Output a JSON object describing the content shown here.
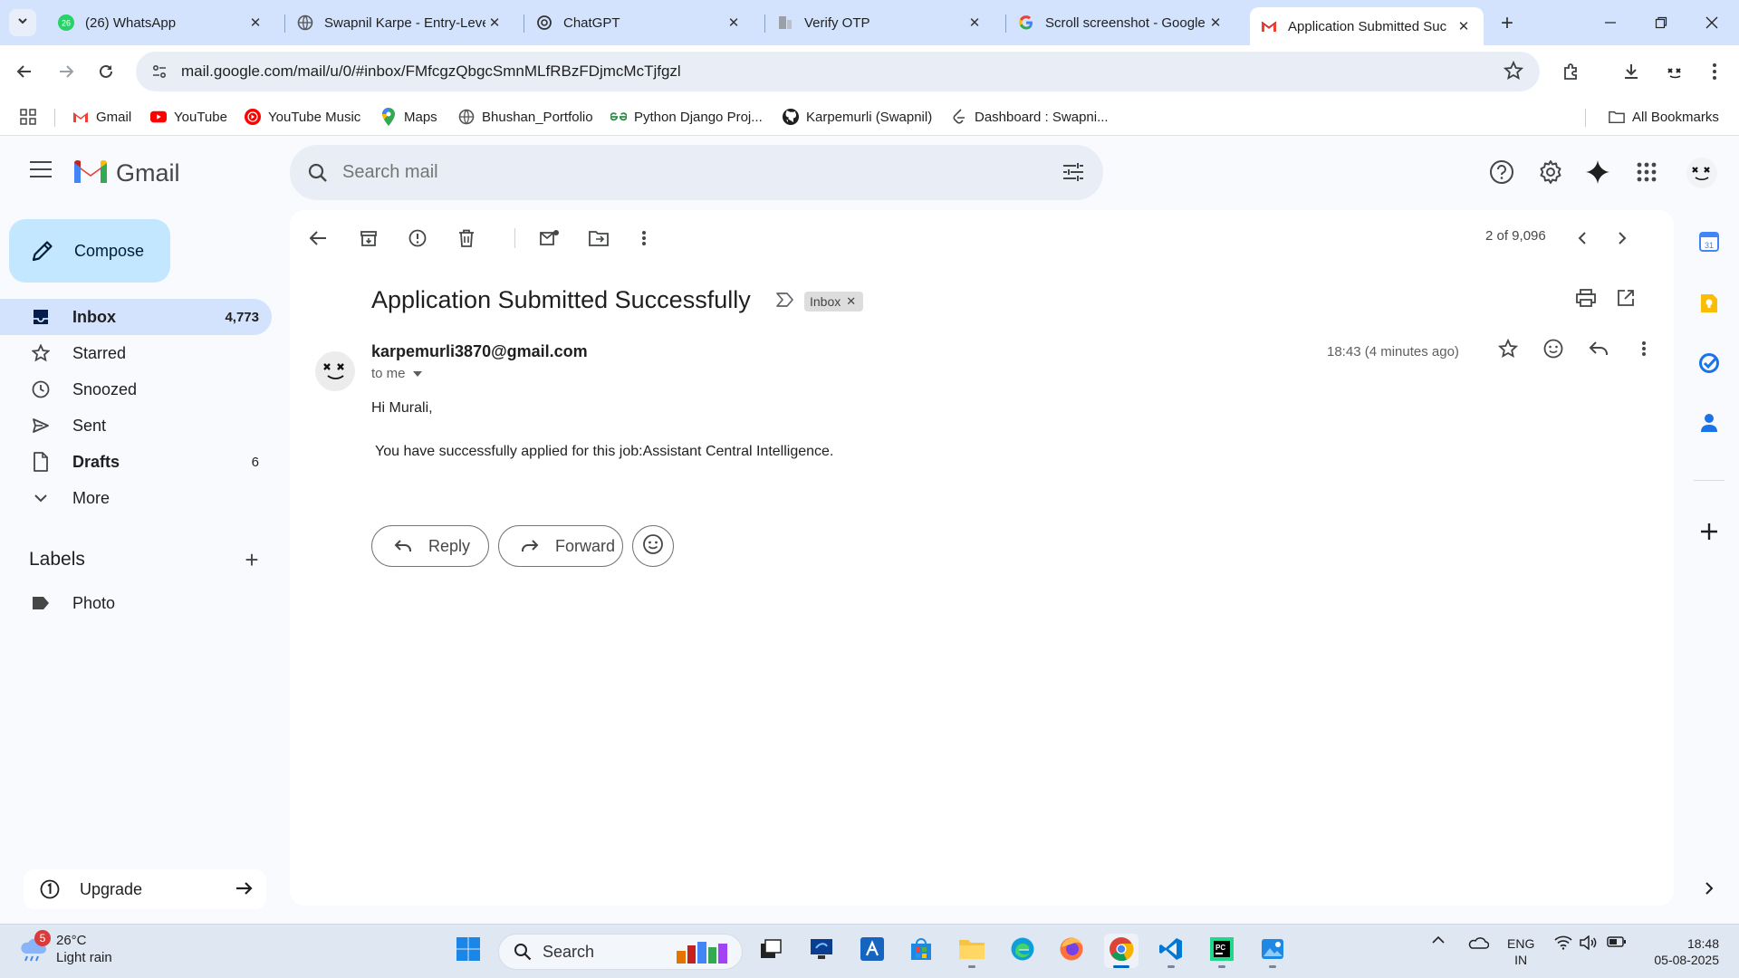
{
  "browser": {
    "tabs": [
      {
        "title": "(26) WhatsApp",
        "badge": "26",
        "icon": "whatsapp-icon"
      },
      {
        "title": "Swapnil Karpe - Entry-Leve",
        "icon": "globe-icon"
      },
      {
        "title": "ChatGPT",
        "icon": "chatgpt-icon"
      },
      {
        "title": "Verify OTP",
        "icon": "document-icon"
      },
      {
        "title": "Scroll screenshot - Google",
        "icon": "google-icon"
      },
      {
        "title": "Application Submitted Suc",
        "icon": "gmail-icon",
        "active": true
      }
    ],
    "url": "mail.google.com/mail/u/0/#inbox/FMfcgzQbgcSmnMLfRBzFDjmcMcTjfgzl",
    "bookmarks": [
      {
        "label": "Gmail",
        "icon": "gmail-icon"
      },
      {
        "label": "YouTube",
        "icon": "youtube-icon"
      },
      {
        "label": "YouTube Music",
        "icon": "youtube-music-icon"
      },
      {
        "label": "Maps",
        "icon": "maps-pin-icon"
      },
      {
        "label": "Bhushan_Portfolio",
        "icon": "globe-icon"
      },
      {
        "label": "Python Django Proj...",
        "icon": "geeks-icon"
      },
      {
        "label": "Karpemurli (Swapnil)",
        "icon": "github-icon"
      },
      {
        "label": "Dashboard : Swapni...",
        "icon": "leetcode-icon"
      }
    ],
    "all_bookmarks": "All Bookmarks"
  },
  "gmail": {
    "brand": "Gmail",
    "search_placeholder": "Search mail",
    "compose": "Compose",
    "nav": [
      {
        "label": "Inbox",
        "count": "4,773",
        "icon": "inbox-icon",
        "active": true,
        "bold": true
      },
      {
        "label": "Starred",
        "count": "",
        "icon": "star-icon"
      },
      {
        "label": "Snoozed",
        "count": "",
        "icon": "clock-icon"
      },
      {
        "label": "Sent",
        "count": "",
        "icon": "send-icon"
      },
      {
        "label": "Drafts",
        "count": "6",
        "icon": "draft-icon",
        "bold": true
      },
      {
        "label": "More",
        "count": "",
        "icon": "chevron-down-icon"
      }
    ],
    "labels_heading": "Labels",
    "labels": [
      {
        "label": "Photo",
        "icon": "label-icon"
      }
    ],
    "upgrade": "Upgrade",
    "pager": "2 of 9,096",
    "message": {
      "subject": "Application Submitted Successfully",
      "chip": "Inbox",
      "sender": "karpemurli3870@gmail.com",
      "to": "to me",
      "time": "18:43 (4 minutes ago)",
      "greeting": "Hi Murali,",
      "body": "You have successfully applied for this job:Assistant Central Intelligence."
    },
    "reply": "Reply",
    "forward": "Forward"
  },
  "taskbar": {
    "weather_temp": "26°C",
    "weather_desc": "Light rain",
    "weather_badge": "5",
    "search": "Search",
    "lang_top": "ENG",
    "lang_bottom": "IN",
    "time": "18:48",
    "date": "05-08-2025"
  }
}
